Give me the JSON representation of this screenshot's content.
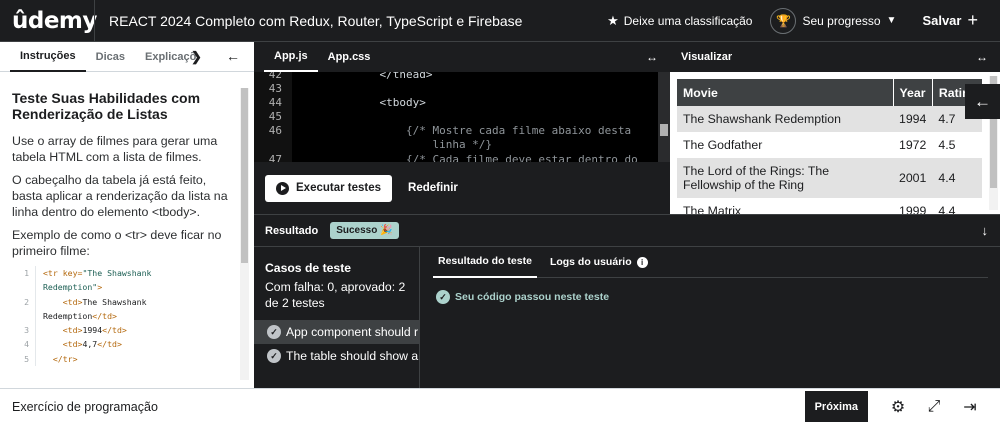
{
  "header": {
    "logo": "ûdemy",
    "course_title": "REACT 2024 Completo com Redux, Router, TypeScript e Firebase",
    "rate_label": "Deixe uma classificação",
    "progress_label": "Seu progresso",
    "save_label": "Salvar"
  },
  "left_panel": {
    "tabs": [
      "Instruções",
      "Dicas",
      "Explicaçõ"
    ],
    "heading": "Teste Suas Habilidades com Renderização de Listas",
    "paragraphs": [
      "Use o array de filmes para gerar uma tabela HTML com a lista de filmes.",
      "O cabeçalho da tabela já está feito, basta aplicar a renderização da lista na linha dentro do elemento <tbody>.",
      "Exemplo de como o <tr> deve ficar no primeiro filme:"
    ],
    "code_example": [
      {
        "num": "1",
        "tag1": "<tr key=",
        "str": "\"The Shawshank",
        "tag2": ""
      },
      {
        "num": "",
        "tag1": "",
        "str": "Redemption\"",
        "tag2": ">"
      },
      {
        "num": "2",
        "tag1": "    <td>",
        "str": "",
        "text": "The Shawshank",
        "tag2": ""
      },
      {
        "num": "",
        "tag1": "",
        "str": "",
        "text": "Redemption",
        "tag2": "</td>"
      },
      {
        "num": "3",
        "tag1": "    <td>",
        "str": "",
        "text": "1994",
        "tag2": "</td>"
      },
      {
        "num": "4",
        "tag1": "    <td>",
        "str": "",
        "text": "4,7",
        "tag2": "</td>"
      },
      {
        "num": "5",
        "tag1": "  </tr>",
        "str": "",
        "text": "",
        "tag2": ""
      }
    ]
  },
  "editor": {
    "tabs": [
      "App.js",
      "App.css"
    ],
    "lines": [
      {
        "num": "42",
        "text": "            </thead>",
        "comment": false
      },
      {
        "num": "43",
        "text": "",
        "comment": false
      },
      {
        "num": "44",
        "text": "            <tbody>",
        "comment": false
      },
      {
        "num": "45",
        "text": "",
        "comment": false
      },
      {
        "num": "46",
        "text": "                {/* Mostre cada filme abaixo desta",
        "comment": true
      },
      {
        "num": "",
        "text": "                    linha */}",
        "comment": true
      },
      {
        "num": "47",
        "text": "                {/* Cada filme deve estar dentro do",
        "comment": true
      }
    ],
    "run_label": "Executar testes",
    "reset_label": "Redefinir"
  },
  "preview": {
    "title": "Visualizar",
    "columns": [
      "Movie",
      "Year",
      "Ratin"
    ],
    "rows": [
      {
        "movie": "The Shawshank Redemption",
        "year": "1994",
        "rating": "4.7"
      },
      {
        "movie": "The Godfather",
        "year": "1972",
        "rating": "4.5"
      },
      {
        "movie": "The Lord of the Rings: The Fellowship of the Ring",
        "year": "2001",
        "rating": "4.4"
      },
      {
        "movie": "The Matrix",
        "year": "1999",
        "rating": "4.4"
      }
    ]
  },
  "results": {
    "title": "Resultado",
    "badge": "Sucesso 🎉",
    "cases_title": "Casos de teste",
    "cases_summary": "Com falha: 0, aprovado: 2 de 2 testes",
    "cases": [
      "App component should r",
      "The table should show a"
    ],
    "tabs": [
      "Resultado do teste",
      "Logs do usuário"
    ],
    "pass_message": "Seu código passou neste teste"
  },
  "footer": {
    "title": "Exercício de programação",
    "next_label": "Próxima"
  },
  "icons": {
    "star": "star-icon",
    "trophy": "trophy-icon",
    "settings": "gear-icon",
    "fullscreen": "expand-icon",
    "collapse": "collapse-icon"
  }
}
